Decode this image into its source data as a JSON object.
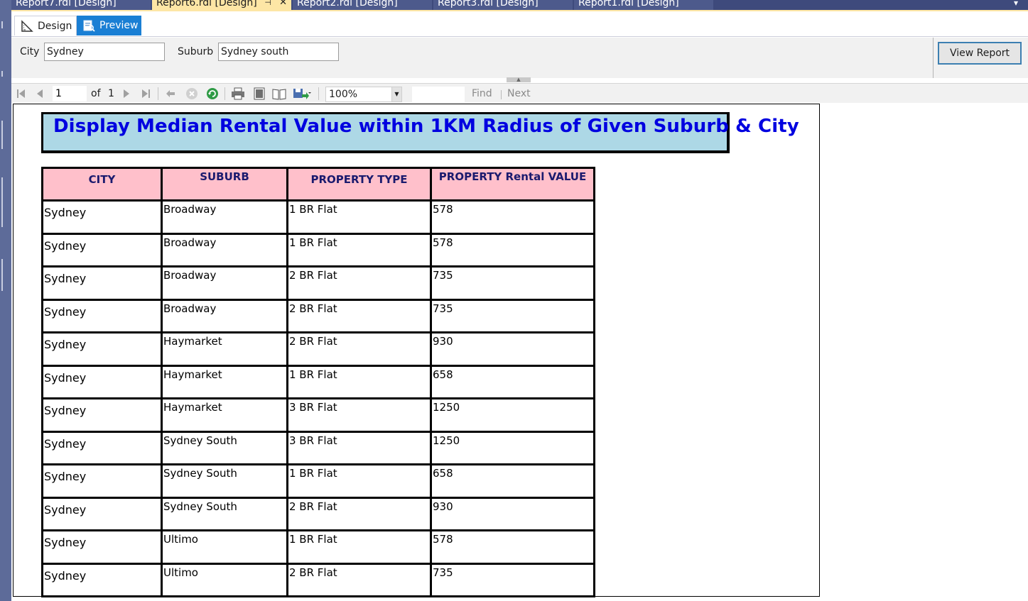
{
  "document_tabs": [
    {
      "label": "Report7.rdl [Design]",
      "active": false
    },
    {
      "label": "Report6.rdl [Design]",
      "active": true
    },
    {
      "label": "Report2.rdl [Design]",
      "active": false
    },
    {
      "label": "Report3.rdl [Design]",
      "active": false
    },
    {
      "label": "Report1.rdl [Design]",
      "active": false
    }
  ],
  "mode_tabs": {
    "design_label": "Design",
    "preview_label": "Preview",
    "active": "Preview"
  },
  "parameters": {
    "city_label": "City",
    "city_value": "Sydney",
    "suburb_label": "Suburb",
    "suburb_value": "Sydney south",
    "view_report_label": "View Report"
  },
  "toolbar": {
    "current_page": "1",
    "of_label": "of",
    "total_pages": "1",
    "zoom": "100%",
    "find_value": "",
    "find_label": "Find",
    "next_label": "Next"
  },
  "report": {
    "title": "Display Median Rental Value within 1KM Radius of Given Suburb & City",
    "columns": [
      "CITY",
      "SUBURB",
      "PROPERTY TYPE",
      "PROPERTY Rental VALUE"
    ],
    "rows": [
      [
        "Sydney",
        "Broadway",
        "1 BR Flat",
        "578"
      ],
      [
        "Sydney",
        "Broadway",
        "1 BR Flat",
        "578"
      ],
      [
        "Sydney",
        "Broadway",
        "2 BR Flat",
        "735"
      ],
      [
        "Sydney",
        "Broadway",
        "2 BR Flat",
        "735"
      ],
      [
        "Sydney",
        "Haymarket",
        "2 BR Flat",
        "930"
      ],
      [
        "Sydney",
        "Haymarket",
        "1 BR Flat",
        "658"
      ],
      [
        "Sydney",
        "Haymarket",
        "3 BR Flat",
        "1250"
      ],
      [
        "Sydney",
        "Sydney South",
        "3 BR Flat",
        "1250"
      ],
      [
        "Sydney",
        "Sydney South",
        "1 BR Flat",
        "658"
      ],
      [
        "Sydney",
        "Sydney South",
        "2 BR Flat",
        "930"
      ],
      [
        "Sydney",
        "Ultimo",
        "1 BR Flat",
        "578"
      ],
      [
        "Sydney",
        "Ultimo",
        "2 BR Flat",
        "735"
      ]
    ]
  },
  "colors": {
    "title_background": "#add8e6",
    "title_text": "#0000e0",
    "header_background": "#ffc0cb",
    "header_text": "#1a1a6e",
    "preview_tab": "#1a7fd4",
    "active_doc_tab": "#fde6a5"
  },
  "icons": {
    "design_tab": "design-ruler-icon",
    "preview_tab": "preview-report-icon",
    "toolbar": [
      "first-page-icon",
      "previous-page-icon",
      "next-page-icon",
      "last-page-icon",
      "back-icon",
      "stop-icon",
      "refresh-icon",
      "print-icon",
      "print-layout-icon",
      "page-setup-icon",
      "export-icon"
    ]
  }
}
